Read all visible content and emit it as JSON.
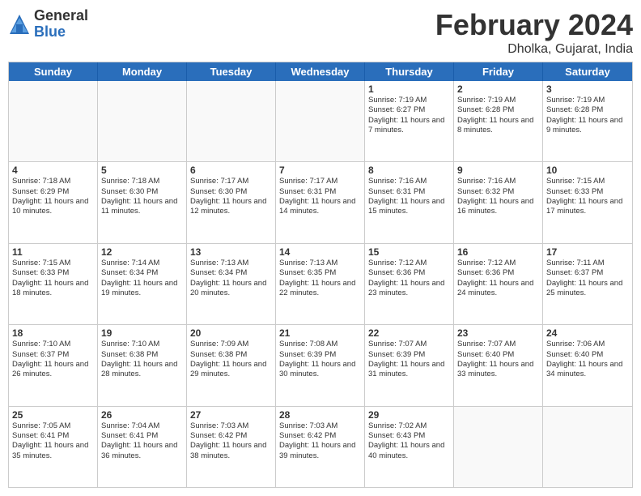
{
  "header": {
    "logo_general": "General",
    "logo_blue": "Blue",
    "title": "February 2024",
    "subtitle": "Dholka, Gujarat, India"
  },
  "calendar": {
    "days": [
      "Sunday",
      "Monday",
      "Tuesday",
      "Wednesday",
      "Thursday",
      "Friday",
      "Saturday"
    ],
    "rows": [
      [
        {
          "day": "",
          "empty": true
        },
        {
          "day": "",
          "empty": true
        },
        {
          "day": "",
          "empty": true
        },
        {
          "day": "",
          "empty": true
        },
        {
          "day": "1",
          "sunrise": "7:19 AM",
          "sunset": "6:27 PM",
          "daylight": "11 hours and 7 minutes."
        },
        {
          "day": "2",
          "sunrise": "7:19 AM",
          "sunset": "6:28 PM",
          "daylight": "11 hours and 8 minutes."
        },
        {
          "day": "3",
          "sunrise": "7:19 AM",
          "sunset": "6:28 PM",
          "daylight": "11 hours and 9 minutes."
        }
      ],
      [
        {
          "day": "4",
          "sunrise": "7:18 AM",
          "sunset": "6:29 PM",
          "daylight": "11 hours and 10 minutes."
        },
        {
          "day": "5",
          "sunrise": "7:18 AM",
          "sunset": "6:30 PM",
          "daylight": "11 hours and 11 minutes."
        },
        {
          "day": "6",
          "sunrise": "7:17 AM",
          "sunset": "6:30 PM",
          "daylight": "11 hours and 12 minutes."
        },
        {
          "day": "7",
          "sunrise": "7:17 AM",
          "sunset": "6:31 PM",
          "daylight": "11 hours and 14 minutes."
        },
        {
          "day": "8",
          "sunrise": "7:16 AM",
          "sunset": "6:31 PM",
          "daylight": "11 hours and 15 minutes."
        },
        {
          "day": "9",
          "sunrise": "7:16 AM",
          "sunset": "6:32 PM",
          "daylight": "11 hours and 16 minutes."
        },
        {
          "day": "10",
          "sunrise": "7:15 AM",
          "sunset": "6:33 PM",
          "daylight": "11 hours and 17 minutes."
        }
      ],
      [
        {
          "day": "11",
          "sunrise": "7:15 AM",
          "sunset": "6:33 PM",
          "daylight": "11 hours and 18 minutes."
        },
        {
          "day": "12",
          "sunrise": "7:14 AM",
          "sunset": "6:34 PM",
          "daylight": "11 hours and 19 minutes."
        },
        {
          "day": "13",
          "sunrise": "7:13 AM",
          "sunset": "6:34 PM",
          "daylight": "11 hours and 20 minutes."
        },
        {
          "day": "14",
          "sunrise": "7:13 AM",
          "sunset": "6:35 PM",
          "daylight": "11 hours and 22 minutes."
        },
        {
          "day": "15",
          "sunrise": "7:12 AM",
          "sunset": "6:36 PM",
          "daylight": "11 hours and 23 minutes."
        },
        {
          "day": "16",
          "sunrise": "7:12 AM",
          "sunset": "6:36 PM",
          "daylight": "11 hours and 24 minutes."
        },
        {
          "day": "17",
          "sunrise": "7:11 AM",
          "sunset": "6:37 PM",
          "daylight": "11 hours and 25 minutes."
        }
      ],
      [
        {
          "day": "18",
          "sunrise": "7:10 AM",
          "sunset": "6:37 PM",
          "daylight": "11 hours and 26 minutes."
        },
        {
          "day": "19",
          "sunrise": "7:10 AM",
          "sunset": "6:38 PM",
          "daylight": "11 hours and 28 minutes."
        },
        {
          "day": "20",
          "sunrise": "7:09 AM",
          "sunset": "6:38 PM",
          "daylight": "11 hours and 29 minutes."
        },
        {
          "day": "21",
          "sunrise": "7:08 AM",
          "sunset": "6:39 PM",
          "daylight": "11 hours and 30 minutes."
        },
        {
          "day": "22",
          "sunrise": "7:07 AM",
          "sunset": "6:39 PM",
          "daylight": "11 hours and 31 minutes."
        },
        {
          "day": "23",
          "sunrise": "7:07 AM",
          "sunset": "6:40 PM",
          "daylight": "11 hours and 33 minutes."
        },
        {
          "day": "24",
          "sunrise": "7:06 AM",
          "sunset": "6:40 PM",
          "daylight": "11 hours and 34 minutes."
        }
      ],
      [
        {
          "day": "25",
          "sunrise": "7:05 AM",
          "sunset": "6:41 PM",
          "daylight": "11 hours and 35 minutes."
        },
        {
          "day": "26",
          "sunrise": "7:04 AM",
          "sunset": "6:41 PM",
          "daylight": "11 hours and 36 minutes."
        },
        {
          "day": "27",
          "sunrise": "7:03 AM",
          "sunset": "6:42 PM",
          "daylight": "11 hours and 38 minutes."
        },
        {
          "day": "28",
          "sunrise": "7:03 AM",
          "sunset": "6:42 PM",
          "daylight": "11 hours and 39 minutes."
        },
        {
          "day": "29",
          "sunrise": "7:02 AM",
          "sunset": "6:43 PM",
          "daylight": "11 hours and 40 minutes."
        },
        {
          "day": "",
          "empty": true
        },
        {
          "day": "",
          "empty": true
        }
      ]
    ]
  }
}
